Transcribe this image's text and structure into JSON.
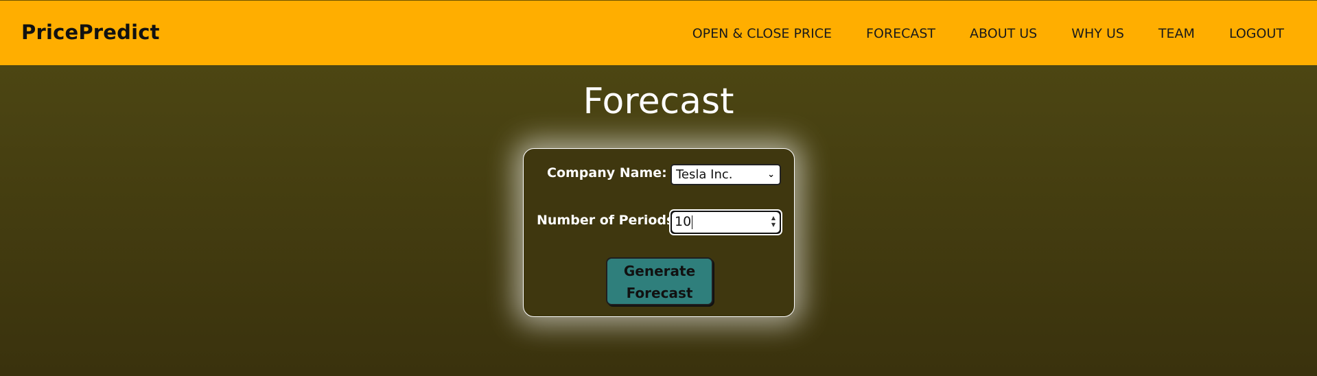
{
  "header": {
    "brand": "PricePredict",
    "nav": [
      {
        "label": "OPEN & CLOSE PRICE"
      },
      {
        "label": "FORECAST"
      },
      {
        "label": "ABOUT US"
      },
      {
        "label": "WHY US"
      },
      {
        "label": "TEAM"
      },
      {
        "label": "LOGOUT"
      }
    ]
  },
  "main": {
    "title": "Forecast",
    "form": {
      "company_label": "Company Name:",
      "company_value": "Tesla Inc.",
      "periods_label": "Number of Periods:",
      "periods_value": "10",
      "button_line1": "Generate",
      "button_line2": "Forecast"
    }
  },
  "colors": {
    "navbar": "#ffae00",
    "background": "#4a4313",
    "button": "#2f7f7c"
  },
  "icons": {
    "select_chevron": "chevron-down-icon",
    "stepper": "number-stepper-icon"
  }
}
